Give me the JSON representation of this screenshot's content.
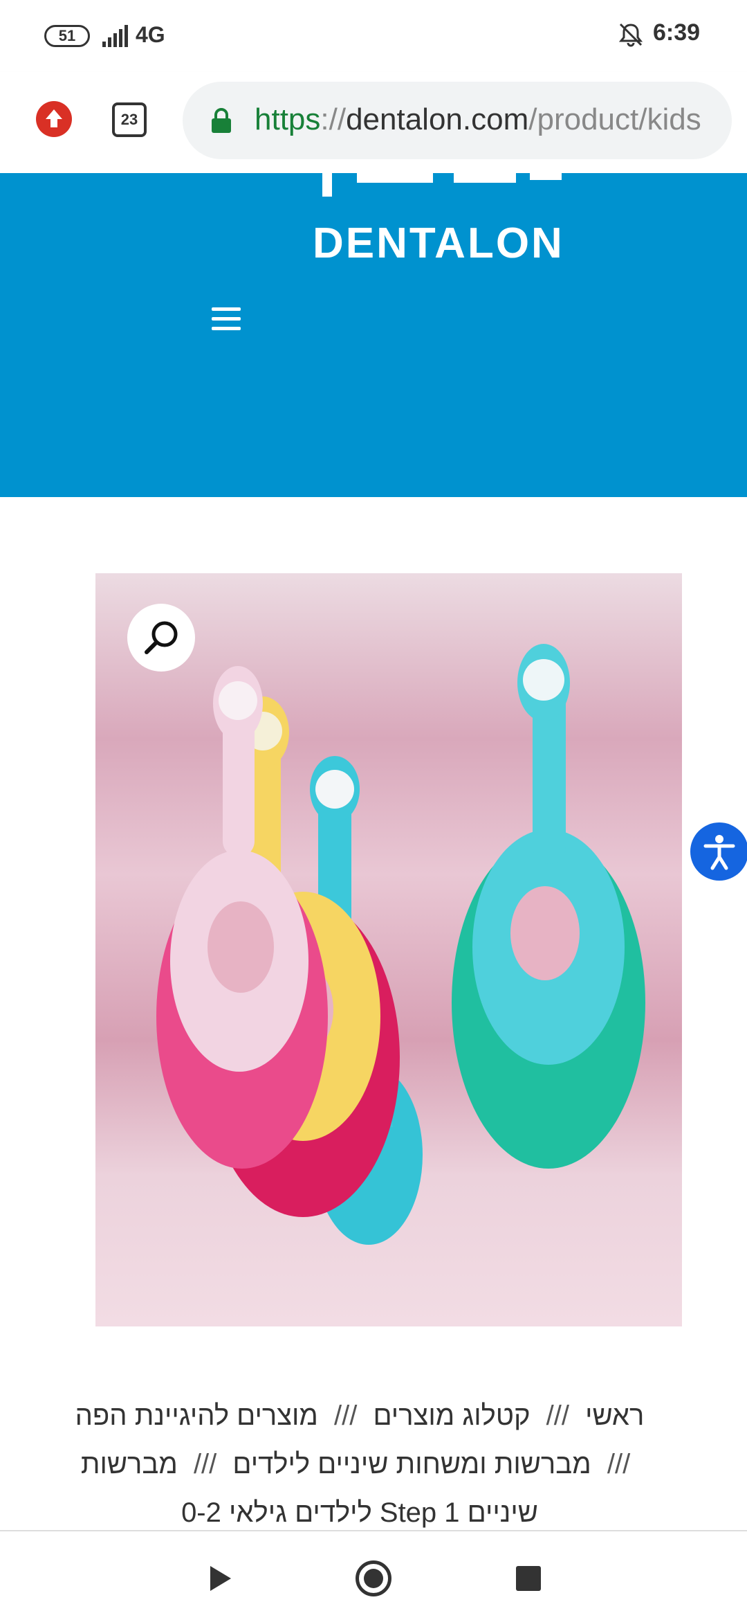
{
  "status_bar": {
    "battery": "51",
    "network": "4G",
    "time": "6:39"
  },
  "browser": {
    "tab_count": "23",
    "url_scheme": "https",
    "url_separator": "://",
    "url_host": "dentalon.com",
    "url_path": "/product/kids"
  },
  "header": {
    "logo_text": "DENTALON"
  },
  "breadcrumb": {
    "items": [
      "ראשי",
      "קטלוג מוצרים",
      "מוצרים להיגיינת הפה",
      "מברשות ומשחות שיניים לילדים"
    ],
    "separator": "///",
    "current": "מברשות שיניים Step 1 לילדים גילאי 0-2"
  },
  "colors": {
    "header_bg": "#0092cf",
    "accessibility_button": "#1565e0",
    "home_button": "#d93025",
    "url_scheme": "#188038"
  },
  "icons": [
    "upload-icon",
    "tabs-icon",
    "lock-icon",
    "menu-icon",
    "search-icon",
    "accessibility-icon",
    "back-icon",
    "home-icon",
    "recents-icon"
  ]
}
